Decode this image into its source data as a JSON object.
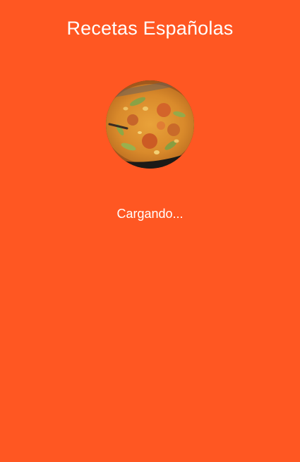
{
  "app": {
    "title": "Recetas Españolas"
  },
  "splash": {
    "image_icon": "paella-image",
    "loading_label": "Cargando..."
  },
  "colors": {
    "background": "#FF5722",
    "text": "#FFFFFF"
  }
}
